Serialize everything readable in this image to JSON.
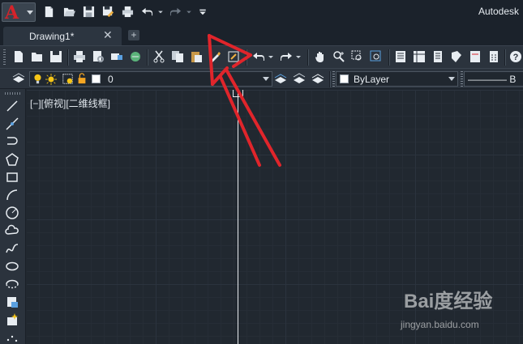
{
  "app": {
    "title": "Autodesk",
    "logo_letter": "A"
  },
  "tabs": [
    {
      "label": "Drawing1*",
      "close_glyph": "✕"
    }
  ],
  "new_tab_glyph": "+",
  "quick_access": {
    "icons": [
      "new-icon",
      "open-icon",
      "save-icon",
      "save-as-icon",
      "plot-icon",
      "undo-icon",
      "redo-icon",
      "customize-dropdown-icon"
    ]
  },
  "layer_bar": {
    "layer_value": "0",
    "color_value": "ByLayer",
    "linetype_value": "———— B"
  },
  "viewport": {
    "label": "[−][俯视][二维线框]"
  },
  "left_toolbar": {
    "icons": [
      "line-icon",
      "construction-line-icon",
      "polyline-icon",
      "polygon-icon",
      "rectangle-icon",
      "arc-icon",
      "circle-icon",
      "revision-cloud-icon",
      "spline-icon",
      "ellipse-icon",
      "ellipse-arc-icon",
      "insert-block-icon",
      "make-block-icon",
      "point-icon"
    ]
  },
  "watermark": {
    "brand": "Bai度经验",
    "url": "jingyan.baidu.com"
  },
  "colors": {
    "annotation_arrow": "#e0252b",
    "app_logo": "#d6232a",
    "canvas_bg": "#212830"
  }
}
